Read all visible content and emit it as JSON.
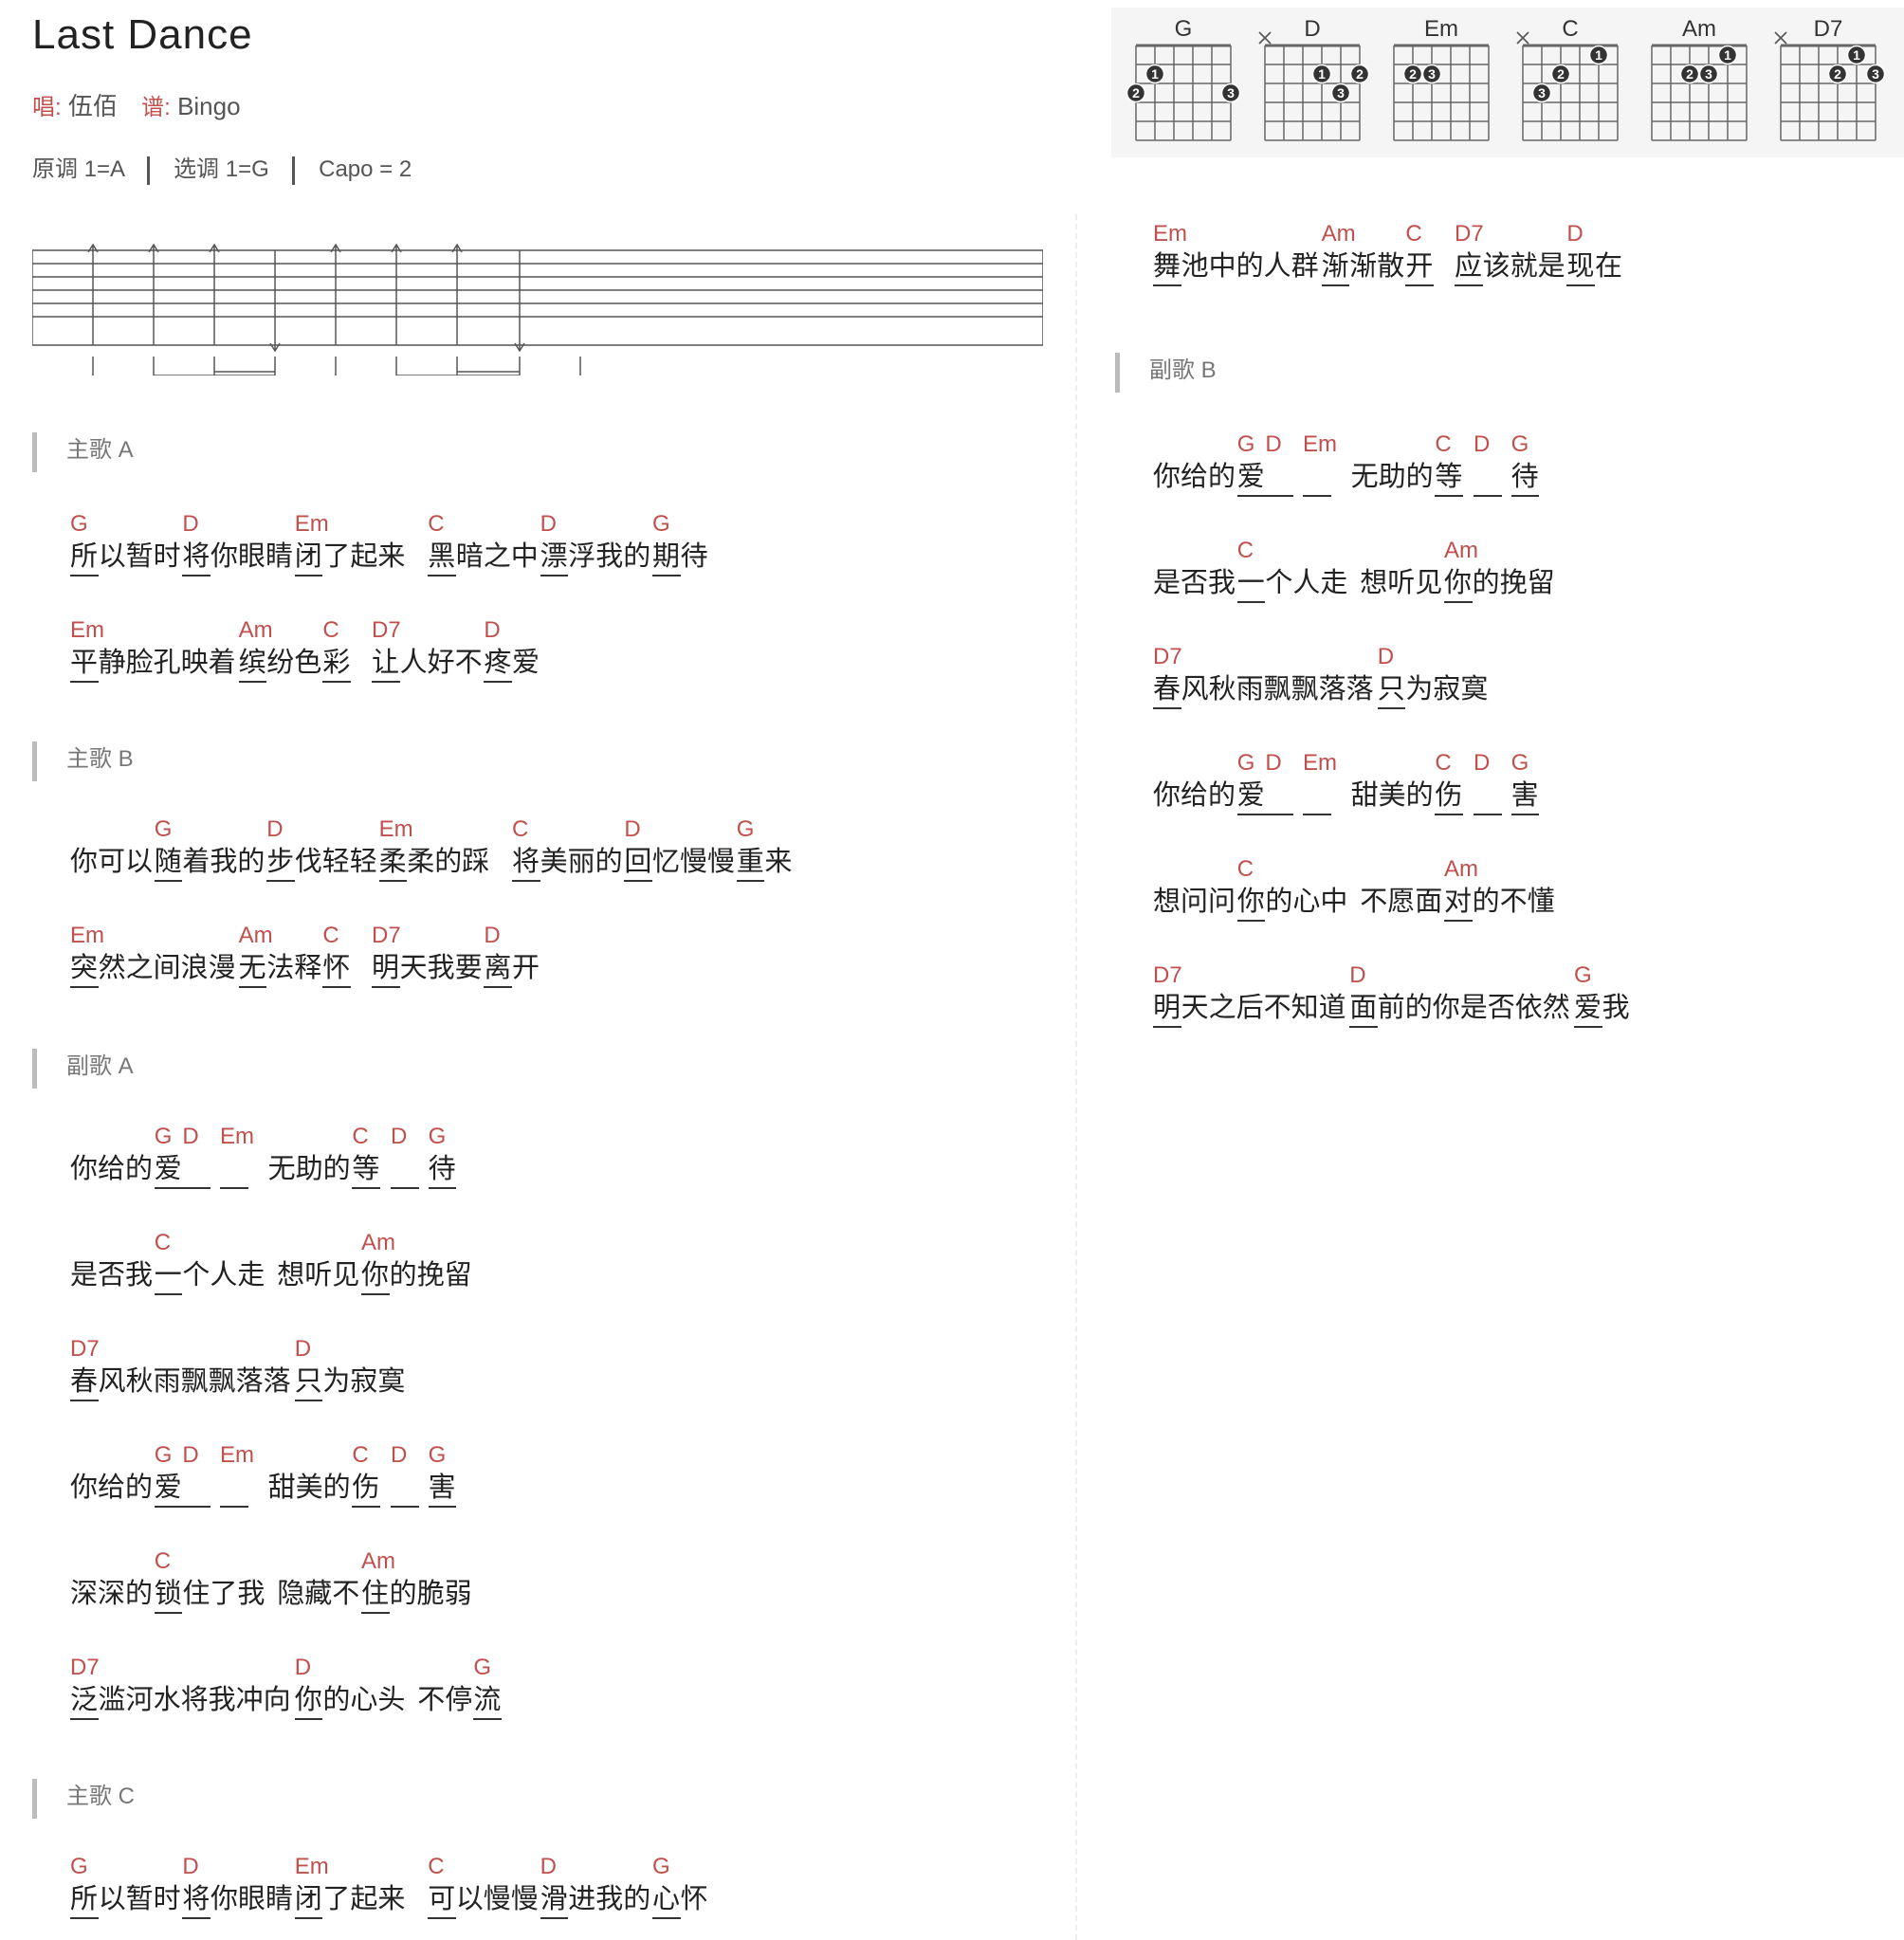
{
  "title": "Last Dance",
  "meta": {
    "singer_label": "唱:",
    "singer": "伍佰",
    "score_label": "谱:",
    "score": "Bingo"
  },
  "keys": {
    "original": "原调 1=A",
    "selected": "选调 1=G",
    "capo": "Capo = 2"
  },
  "chord_diagrams": [
    {
      "name": "G",
      "mute": null,
      "dots": [
        [
          2,
          1,
          "1"
        ],
        [
          3,
          0,
          "2"
        ],
        [
          3,
          5,
          "3"
        ]
      ]
    },
    {
      "name": "D",
      "mute": 0,
      "dots": [
        [
          2,
          3,
          "1"
        ],
        [
          2,
          5,
          "2"
        ],
        [
          3,
          4,
          "3"
        ]
      ]
    },
    {
      "name": "Em",
      "mute": null,
      "dots": [
        [
          2,
          1,
          "2"
        ],
        [
          2,
          2,
          "3"
        ]
      ]
    },
    {
      "name": "C",
      "mute": 0,
      "dots": [
        [
          1,
          4,
          "1"
        ],
        [
          2,
          2,
          "2"
        ],
        [
          3,
          1,
          "3"
        ]
      ]
    },
    {
      "name": "Am",
      "mute": null,
      "dots": [
        [
          1,
          4,
          "1"
        ],
        [
          2,
          2,
          "2"
        ],
        [
          2,
          3,
          "3"
        ]
      ]
    },
    {
      "name": "D7",
      "mute": 0,
      "dots": [
        [
          1,
          4,
          "1"
        ],
        [
          2,
          3,
          "2"
        ],
        [
          2,
          5,
          "3"
        ]
      ]
    }
  ],
  "sections": [
    {
      "label": "主歌 A",
      "lines": [
        [
          {
            "t": "所",
            "c": "G"
          },
          {
            "t": "以暂时"
          },
          {
            "t": "将",
            "c": "D"
          },
          {
            "t": "你眼睛"
          },
          {
            "t": "闭",
            "c": "Em"
          },
          {
            "t": "了起来"
          },
          {
            "gap": 2
          },
          {
            "t": "黑",
            "c": "C"
          },
          {
            "t": "暗之中"
          },
          {
            "t": "漂",
            "c": "D"
          },
          {
            "t": "浮我的"
          },
          {
            "t": "期",
            "c": "G"
          },
          {
            "t": "待"
          }
        ],
        [
          {
            "t": "平",
            "c": "Em"
          },
          {
            "t": "静脸孔映着"
          },
          {
            "t": "缤",
            "c": "Am"
          },
          {
            "t": "纷色"
          },
          {
            "t": "彩",
            "c": "C"
          },
          {
            "gap": 2
          },
          {
            "t": "让",
            "c": "D7"
          },
          {
            "t": "人好不"
          },
          {
            "t": "疼",
            "c": "D"
          },
          {
            "t": "爱"
          }
        ]
      ]
    },
    {
      "label": "主歌 B",
      "lines": [
        [
          {
            "t": "你可以"
          },
          {
            "t": "随",
            "c": "G"
          },
          {
            "t": "着我的"
          },
          {
            "t": "步",
            "c": "D"
          },
          {
            "t": "伐轻轻"
          },
          {
            "t": "柔",
            "c": "Em"
          },
          {
            "t": "柔的踩"
          },
          {
            "gap": 2
          },
          {
            "t": "将",
            "c": "C"
          },
          {
            "t": "美丽的"
          },
          {
            "t": "回",
            "c": "D"
          },
          {
            "t": "忆慢慢"
          },
          {
            "t": "重",
            "c": "G"
          },
          {
            "t": "来"
          }
        ],
        [
          {
            "t": "突",
            "c": "Em"
          },
          {
            "t": "然之间浪漫"
          },
          {
            "t": "无",
            "c": "Am"
          },
          {
            "t": "法释"
          },
          {
            "t": "怀",
            "c": "C"
          },
          {
            "gap": 2
          },
          {
            "t": "明",
            "c": "D7"
          },
          {
            "t": "天我要"
          },
          {
            "t": "离",
            "c": "D"
          },
          {
            "t": "开"
          }
        ]
      ]
    },
    {
      "label": "副歌 A",
      "lines": [
        [
          {
            "t": "你给的"
          },
          {
            "t": "爱",
            "c": "G"
          },
          {
            "t": "_",
            "c": "D"
          },
          {
            "t": "_",
            "c": "Em"
          },
          {
            "gap": 1
          },
          {
            "t": "无助的"
          },
          {
            "t": "等",
            "c": "C"
          },
          {
            "gap": 1
          },
          {
            "t": "_",
            "c": "D"
          },
          {
            "t": "待",
            "c": "G"
          }
        ],
        [
          {
            "t": "是否我"
          },
          {
            "t": "一",
            "c": "C"
          },
          {
            "t": "个人走"
          },
          {
            "gap": 1
          },
          {
            "t": "想听见"
          },
          {
            "t": "你",
            "c": "Am"
          },
          {
            "t": "的挽留"
          }
        ],
        [
          {
            "t": "春",
            "c": "D7"
          },
          {
            "t": "风秋雨飘飘落落"
          },
          {
            "t": "只",
            "c": "D"
          },
          {
            "t": "为寂寞"
          }
        ],
        [
          {
            "t": "你给的"
          },
          {
            "t": "爱",
            "c": "G"
          },
          {
            "t": "_",
            "c": "D"
          },
          {
            "t": "_",
            "c": "Em"
          },
          {
            "gap": 1
          },
          {
            "t": "甜美的"
          },
          {
            "t": "伤",
            "c": "C"
          },
          {
            "gap": 1
          },
          {
            "t": "_",
            "c": "D"
          },
          {
            "t": "害",
            "c": "G"
          }
        ],
        [
          {
            "t": "深深的"
          },
          {
            "t": "锁",
            "c": "C"
          },
          {
            "t": "住了我"
          },
          {
            "gap": 1
          },
          {
            "t": "隐藏不"
          },
          {
            "t": "住",
            "c": "Am"
          },
          {
            "t": "的脆弱"
          }
        ],
        [
          {
            "t": "泛",
            "c": "D7"
          },
          {
            "t": "滥河水将我冲向"
          },
          {
            "t": "你",
            "c": "D"
          },
          {
            "t": "的心头"
          },
          {
            "gap": 1
          },
          {
            "t": "不停"
          },
          {
            "t": "流",
            "c": "G"
          }
        ]
      ]
    },
    {
      "label": "主歌 C",
      "lines": [
        [
          {
            "t": "所",
            "c": "G"
          },
          {
            "t": "以暂时"
          },
          {
            "t": "将",
            "c": "D"
          },
          {
            "t": "你眼睛"
          },
          {
            "t": "闭",
            "c": "Em"
          },
          {
            "t": "了起来"
          },
          {
            "gap": 2
          },
          {
            "t": "可",
            "c": "C"
          },
          {
            "t": "以慢慢"
          },
          {
            "t": "滑",
            "c": "D"
          },
          {
            "t": "进我的"
          },
          {
            "t": "心",
            "c": "G"
          },
          {
            "t": "怀"
          }
        ]
      ]
    },
    {
      "label": "",
      "lines": [
        [
          {
            "t": "舞",
            "c": "Em"
          },
          {
            "t": "池中的人群"
          },
          {
            "t": "渐",
            "c": "Am"
          },
          {
            "t": "渐散"
          },
          {
            "t": "开",
            "c": "C"
          },
          {
            "gap": 2
          },
          {
            "t": "应",
            "c": "D7"
          },
          {
            "t": "该就是"
          },
          {
            "t": "现",
            "c": "D"
          },
          {
            "t": "在"
          }
        ]
      ]
    },
    {
      "label": "副歌 B",
      "lines": [
        [
          {
            "t": "你给的"
          },
          {
            "t": "爱",
            "c": "G"
          },
          {
            "t": "_",
            "c": "D"
          },
          {
            "t": "_",
            "c": "Em"
          },
          {
            "gap": 1
          },
          {
            "t": "无助的"
          },
          {
            "t": "等",
            "c": "C"
          },
          {
            "gap": 1
          },
          {
            "t": "_",
            "c": "D"
          },
          {
            "t": "待",
            "c": "G"
          }
        ],
        [
          {
            "t": "是否我"
          },
          {
            "t": "一",
            "c": "C"
          },
          {
            "t": "个人走"
          },
          {
            "gap": 1
          },
          {
            "t": "想听见"
          },
          {
            "t": "你",
            "c": "Am"
          },
          {
            "t": "的挽留"
          }
        ],
        [
          {
            "t": "春",
            "c": "D7"
          },
          {
            "t": "风秋雨飘飘落落"
          },
          {
            "t": "只",
            "c": "D"
          },
          {
            "t": "为寂寞"
          }
        ],
        [
          {
            "t": "你给的"
          },
          {
            "t": "爱",
            "c": "G"
          },
          {
            "t": "_",
            "c": "D"
          },
          {
            "t": "_",
            "c": "Em"
          },
          {
            "gap": 1
          },
          {
            "t": "甜美的"
          },
          {
            "t": "伤",
            "c": "C"
          },
          {
            "gap": 1
          },
          {
            "t": "_",
            "c": "D"
          },
          {
            "t": "害",
            "c": "G"
          }
        ],
        [
          {
            "t": "想问问"
          },
          {
            "t": "你",
            "c": "C"
          },
          {
            "t": "的心中"
          },
          {
            "gap": 1
          },
          {
            "t": "不愿面"
          },
          {
            "t": "对",
            "c": "Am"
          },
          {
            "t": "的不懂"
          }
        ],
        [
          {
            "t": "明",
            "c": "D7"
          },
          {
            "t": "天之后不知道"
          },
          {
            "t": "面",
            "c": "D"
          },
          {
            "t": "前的你是否依然"
          },
          {
            "t": "爱",
            "c": "G"
          },
          {
            "t": "我"
          }
        ]
      ]
    }
  ],
  "colors": {
    "chord": "#c0504d",
    "lyric": "#222222",
    "panel_bg": "#f5f5f5",
    "section_bar": "#bbbbbb"
  }
}
